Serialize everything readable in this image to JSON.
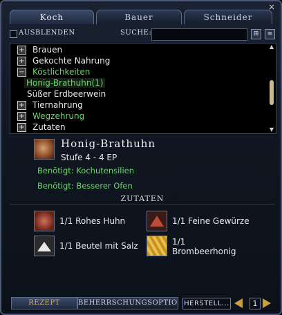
{
  "window": {
    "close_icon": "×"
  },
  "tabs": [
    {
      "label": "Koch",
      "active": true
    },
    {
      "label": "Bauer",
      "active": false
    },
    {
      "label": "Schneider",
      "active": false
    }
  ],
  "toolbar": {
    "hide_label": "Ausblenden",
    "search_label": "Suche:",
    "search_value": ""
  },
  "tree": {
    "items": [
      {
        "label": "Brauen",
        "expander": "+",
        "color": "white"
      },
      {
        "label": "Gekochte Nahrung",
        "expander": "+",
        "color": "white"
      },
      {
        "label": "Köstlichkeiten",
        "expander": "−",
        "color": "green"
      },
      {
        "label": "Honig-Brathuhn(1)",
        "expander": "",
        "color": "green",
        "selected": true
      },
      {
        "label": "Süßer Erdbeerwein",
        "expander": "",
        "color": "white"
      },
      {
        "label": "Tiernahrung",
        "expander": "+",
        "color": "white"
      },
      {
        "label": "Wegzehrung",
        "expander": "+",
        "color": "green"
      },
      {
        "label": "Zutaten",
        "expander": "+",
        "color": "white"
      }
    ]
  },
  "recipe": {
    "title": "Honig-Brathuhn",
    "level": "Stufe 4 - 4 EP",
    "req1": "Benötigt: Kochutensilien",
    "req2": "Benötigt: Besserer Ofen",
    "ingredients_header": "Zutaten",
    "ingredients": [
      {
        "text": "1/1 Rohes Huhn",
        "icon": "raw-chicken-icon",
        "color": "#8a3020"
      },
      {
        "text": "1/1 Feine Gewürze",
        "icon": "spice-pile-icon",
        "color": "#c04a3a"
      },
      {
        "text": "1/1 Beutel mit Salz",
        "icon": "salt-pile-icon",
        "color": "#e8e8e8"
      },
      {
        "text": "1/1",
        "text2": "Brombeerhonig",
        "icon": "honey-comb-icon",
        "color": "#d8a830"
      }
    ]
  },
  "bottom": {
    "tab_recipe": "Rezept",
    "tab_mastery": "Beherrschungsoptio...",
    "make_button": "Herstell...",
    "page": "1"
  }
}
